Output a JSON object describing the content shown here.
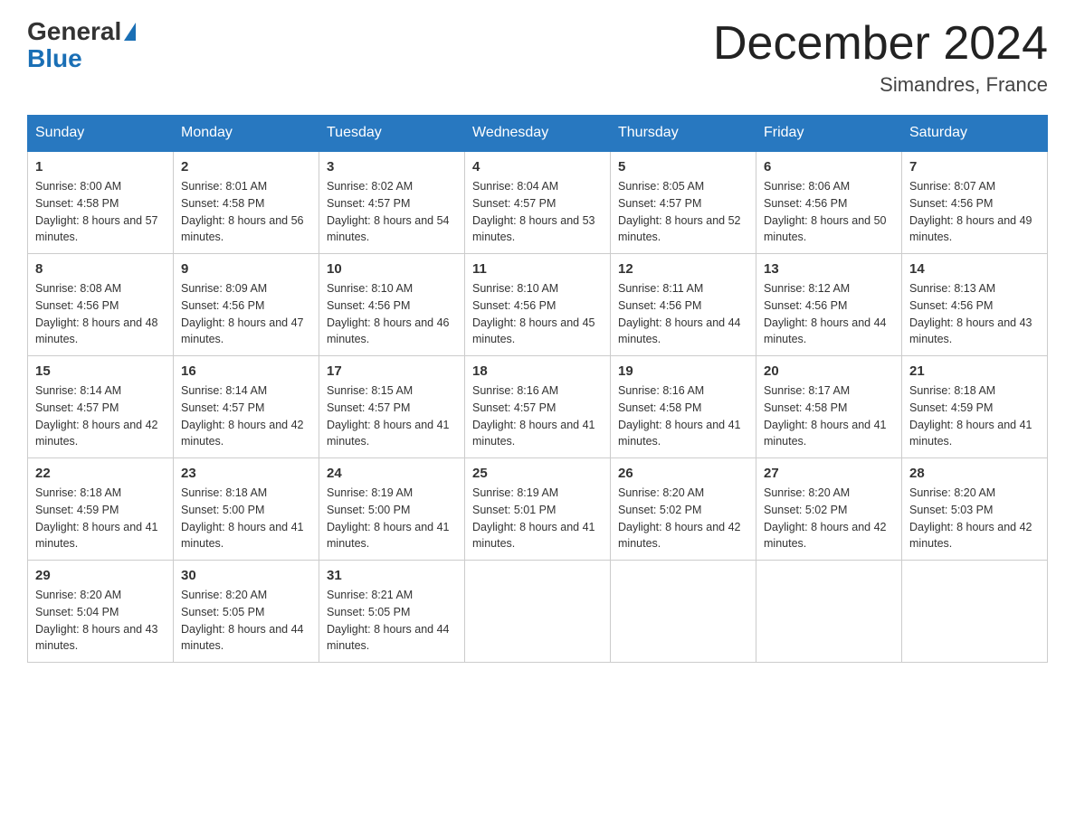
{
  "logo": {
    "general": "General",
    "blue": "Blue"
  },
  "title": "December 2024",
  "location": "Simandres, France",
  "days_of_week": [
    "Sunday",
    "Monday",
    "Tuesday",
    "Wednesday",
    "Thursday",
    "Friday",
    "Saturday"
  ],
  "weeks": [
    [
      {
        "day": "1",
        "sunrise": "8:00 AM",
        "sunset": "4:58 PM",
        "daylight": "8 hours and 57 minutes."
      },
      {
        "day": "2",
        "sunrise": "8:01 AM",
        "sunset": "4:58 PM",
        "daylight": "8 hours and 56 minutes."
      },
      {
        "day": "3",
        "sunrise": "8:02 AM",
        "sunset": "4:57 PM",
        "daylight": "8 hours and 54 minutes."
      },
      {
        "day": "4",
        "sunrise": "8:04 AM",
        "sunset": "4:57 PM",
        "daylight": "8 hours and 53 minutes."
      },
      {
        "day": "5",
        "sunrise": "8:05 AM",
        "sunset": "4:57 PM",
        "daylight": "8 hours and 52 minutes."
      },
      {
        "day": "6",
        "sunrise": "8:06 AM",
        "sunset": "4:56 PM",
        "daylight": "8 hours and 50 minutes."
      },
      {
        "day": "7",
        "sunrise": "8:07 AM",
        "sunset": "4:56 PM",
        "daylight": "8 hours and 49 minutes."
      }
    ],
    [
      {
        "day": "8",
        "sunrise": "8:08 AM",
        "sunset": "4:56 PM",
        "daylight": "8 hours and 48 minutes."
      },
      {
        "day": "9",
        "sunrise": "8:09 AM",
        "sunset": "4:56 PM",
        "daylight": "8 hours and 47 minutes."
      },
      {
        "day": "10",
        "sunrise": "8:10 AM",
        "sunset": "4:56 PM",
        "daylight": "8 hours and 46 minutes."
      },
      {
        "day": "11",
        "sunrise": "8:10 AM",
        "sunset": "4:56 PM",
        "daylight": "8 hours and 45 minutes."
      },
      {
        "day": "12",
        "sunrise": "8:11 AM",
        "sunset": "4:56 PM",
        "daylight": "8 hours and 44 minutes."
      },
      {
        "day": "13",
        "sunrise": "8:12 AM",
        "sunset": "4:56 PM",
        "daylight": "8 hours and 44 minutes."
      },
      {
        "day": "14",
        "sunrise": "8:13 AM",
        "sunset": "4:56 PM",
        "daylight": "8 hours and 43 minutes."
      }
    ],
    [
      {
        "day": "15",
        "sunrise": "8:14 AM",
        "sunset": "4:57 PM",
        "daylight": "8 hours and 42 minutes."
      },
      {
        "day": "16",
        "sunrise": "8:14 AM",
        "sunset": "4:57 PM",
        "daylight": "8 hours and 42 minutes."
      },
      {
        "day": "17",
        "sunrise": "8:15 AM",
        "sunset": "4:57 PM",
        "daylight": "8 hours and 41 minutes."
      },
      {
        "day": "18",
        "sunrise": "8:16 AM",
        "sunset": "4:57 PM",
        "daylight": "8 hours and 41 minutes."
      },
      {
        "day": "19",
        "sunrise": "8:16 AM",
        "sunset": "4:58 PM",
        "daylight": "8 hours and 41 minutes."
      },
      {
        "day": "20",
        "sunrise": "8:17 AM",
        "sunset": "4:58 PM",
        "daylight": "8 hours and 41 minutes."
      },
      {
        "day": "21",
        "sunrise": "8:18 AM",
        "sunset": "4:59 PM",
        "daylight": "8 hours and 41 minutes."
      }
    ],
    [
      {
        "day": "22",
        "sunrise": "8:18 AM",
        "sunset": "4:59 PM",
        "daylight": "8 hours and 41 minutes."
      },
      {
        "day": "23",
        "sunrise": "8:18 AM",
        "sunset": "5:00 PM",
        "daylight": "8 hours and 41 minutes."
      },
      {
        "day": "24",
        "sunrise": "8:19 AM",
        "sunset": "5:00 PM",
        "daylight": "8 hours and 41 minutes."
      },
      {
        "day": "25",
        "sunrise": "8:19 AM",
        "sunset": "5:01 PM",
        "daylight": "8 hours and 41 minutes."
      },
      {
        "day": "26",
        "sunrise": "8:20 AM",
        "sunset": "5:02 PM",
        "daylight": "8 hours and 42 minutes."
      },
      {
        "day": "27",
        "sunrise": "8:20 AM",
        "sunset": "5:02 PM",
        "daylight": "8 hours and 42 minutes."
      },
      {
        "day": "28",
        "sunrise": "8:20 AM",
        "sunset": "5:03 PM",
        "daylight": "8 hours and 42 minutes."
      }
    ],
    [
      {
        "day": "29",
        "sunrise": "8:20 AM",
        "sunset": "5:04 PM",
        "daylight": "8 hours and 43 minutes."
      },
      {
        "day": "30",
        "sunrise": "8:20 AM",
        "sunset": "5:05 PM",
        "daylight": "8 hours and 44 minutes."
      },
      {
        "day": "31",
        "sunrise": "8:21 AM",
        "sunset": "5:05 PM",
        "daylight": "8 hours and 44 minutes."
      },
      null,
      null,
      null,
      null
    ]
  ]
}
